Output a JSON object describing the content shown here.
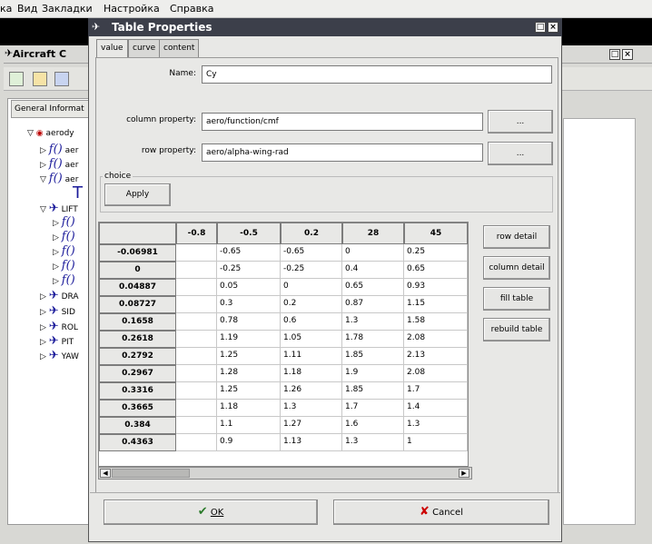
{
  "menubar": {
    "items": [
      "ка",
      "Вид",
      "Закладки",
      "Настройка",
      "Справка"
    ]
  },
  "bg_window": {
    "title": "Aircraft C",
    "panel_tab": "General Informat",
    "tree": [
      {
        "glyph": "▽",
        "icon": "◉",
        "label": "aerody"
      },
      {
        "glyph": "▷",
        "icon": "f()",
        "label": "aer"
      },
      {
        "glyph": "▷",
        "icon": "f()",
        "label": "aer"
      },
      {
        "glyph": "▽",
        "icon": "f()",
        "label": "aer"
      },
      {
        "glyph": "",
        "icon": "T",
        "label": ""
      },
      {
        "glyph": "▽",
        "icon": "✈",
        "label": "LIFT"
      },
      {
        "glyph": "▷",
        "icon": "f()",
        "label": ""
      },
      {
        "glyph": "▷",
        "icon": "f()",
        "label": ""
      },
      {
        "glyph": "▷",
        "icon": "f()",
        "label": ""
      },
      {
        "glyph": "▷",
        "icon": "f()",
        "label": ""
      },
      {
        "glyph": "▷",
        "icon": "f()",
        "label": ""
      },
      {
        "glyph": "▷",
        "icon": "✈",
        "label": "DRA"
      },
      {
        "glyph": "▷",
        "icon": "✈",
        "label": "SID"
      },
      {
        "glyph": "▷",
        "icon": "✈",
        "label": "ROL"
      },
      {
        "glyph": "▷",
        "icon": "✈",
        "label": "PIT"
      },
      {
        "glyph": "▷",
        "icon": "✈",
        "label": "YAW"
      }
    ]
  },
  "dialog": {
    "title": "Table Properties",
    "tabs": [
      "value",
      "curve",
      "content"
    ],
    "name_label": "Name:",
    "name_value": "Cy",
    "column_property_label": "column property:",
    "column_property_value": "aero/function/cmf",
    "row_property_label": "row property:",
    "row_property_value": "aero/alpha-wing-rad",
    "browse_label": "...",
    "choice_label": "choice",
    "apply_label": "Apply",
    "side_buttons": [
      "row detail",
      "column detail",
      "fill table",
      "rebuild table"
    ],
    "ok_label": "OK",
    "cancel_label": "Cancel"
  },
  "table": {
    "column_headers": [
      "-0.8",
      "-0.5",
      "0.2",
      "28",
      "45"
    ],
    "row_headers": [
      "-0.06981",
      "0",
      "0.04887",
      "0.08727",
      "0.1658",
      "0.2618",
      "0.2792",
      "0.2967",
      "0.3316",
      "0.3665",
      "0.384",
      "0.4363"
    ],
    "cells": [
      [
        "",
        "-0.65",
        "-0.65",
        "0",
        "0.25"
      ],
      [
        "",
        "-0.25",
        "-0.25",
        "0.4",
        "0.65"
      ],
      [
        "",
        "0.05",
        "0",
        "0.65",
        "0.93"
      ],
      [
        "",
        "0.3",
        "0.2",
        "0.87",
        "1.15"
      ],
      [
        "",
        "0.78",
        "0.6",
        "1.3",
        "1.58"
      ],
      [
        "",
        "1.19",
        "1.05",
        "1.78",
        "2.08"
      ],
      [
        "",
        "1.25",
        "1.11",
        "1.85",
        "2.13"
      ],
      [
        "",
        "1.28",
        "1.18",
        "1.9",
        "2.08"
      ],
      [
        "",
        "1.25",
        "1.26",
        "1.85",
        "1.7"
      ],
      [
        "",
        "1.18",
        "1.3",
        "1.7",
        "1.4"
      ],
      [
        "",
        "1.1",
        "1.27",
        "1.6",
        "1.3"
      ],
      [
        "",
        "0.9",
        "1.13",
        "1.3",
        "1"
      ]
    ]
  }
}
